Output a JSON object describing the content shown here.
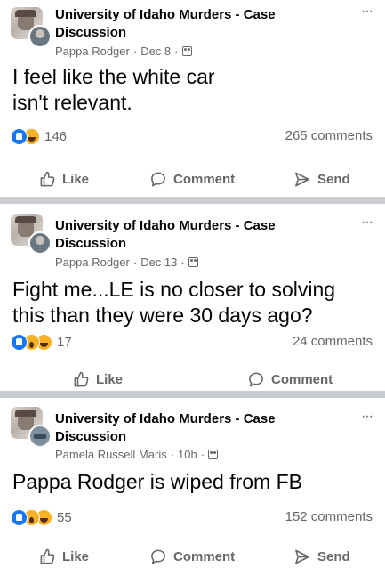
{
  "posts": [
    {
      "group_name": "University of Idaho Murders - Case Discussion",
      "author": "Pappa Rodger",
      "time": "Dec 8",
      "text": "I feel like the white car isn't relevant.",
      "reaction_icons": [
        "like-reaction",
        "haha-reaction"
      ],
      "reaction_count": "146",
      "comments": "265 comments",
      "actions": [
        "Like",
        "Comment",
        "Send"
      ]
    },
    {
      "group_name": "University of Idaho Murders - Case Discussion",
      "author": "Pappa Rodger",
      "time": "Dec 13",
      "text": "Fight me...LE is no closer to solving this than they were 30 days ago?",
      "reaction_icons": [
        "like-reaction",
        "wow-reaction",
        "haha-reaction"
      ],
      "reaction_count": "17",
      "comments": "24 comments",
      "actions": [
        "Like",
        "Comment"
      ]
    },
    {
      "group_name": "University of Idaho Murders - Case Discussion",
      "author": "Pamela Russell Maris",
      "time": "10h",
      "text": "Pappa Rodger is wiped from FB",
      "reaction_icons": [
        "like-reaction",
        "wow-reaction",
        "haha-reaction"
      ],
      "reaction_count": "55",
      "comments": "152 comments",
      "actions": [
        "Like",
        "Comment",
        "Send"
      ]
    }
  ],
  "meta_separator": "·",
  "more_glyph": "···",
  "colors": {
    "like_blue": "#1877f2",
    "reaction_yellow": "#f7b125",
    "secondary_text": "#65676b",
    "separator": "#c9ccd1"
  }
}
